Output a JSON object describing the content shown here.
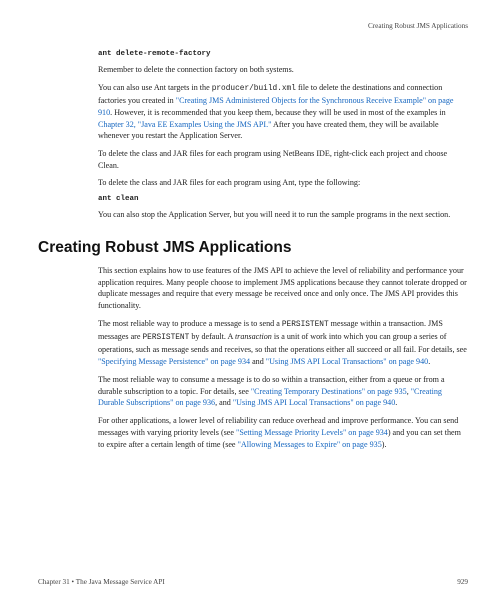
{
  "running_header": "Creating Robust JMS Applications",
  "code1": "ant delete-remote-factory",
  "para1": "Remember to delete the connection factory on both systems.",
  "para2_a": "You can also use Ant targets in the ",
  "para2_mono1": "producer/build.xml",
  "para2_b": " file to delete the destinations and connection factories you created in ",
  "para2_link1": "\"Creating JMS Administered Objects for the Synchronous Receive Example\" on page 910",
  "para2_c": ". However, it is recommended that you keep them, because they will be used in most of the examples in ",
  "para2_link2": "Chapter 32, \"Java EE Examples Using the JMS API.\"",
  "para2_d": " After you have created them, they will be available whenever you restart the Application Server.",
  "para3": "To delete the class and JAR files for each program using NetBeans IDE, right-click each project and choose Clean.",
  "para4": "To delete the class and JAR files for each program using Ant, type the following:",
  "code2": "ant clean",
  "para5": "You can also stop the Application Server, but you will need it to run the sample programs in the next section.",
  "heading": "Creating Robust JMS Applications",
  "para6": "This section explains how to use features of the JMS API to achieve the level of reliability and performance your application requires. Many people choose to implement JMS applications because they cannot tolerate dropped or duplicate messages and require that every message be received once and only once. The JMS API provides this functionality.",
  "para7_a": "The most reliable way to produce a message is to send a ",
  "para7_mono1": "PERSISTENT",
  "para7_b": " message within a transaction. JMS messages are ",
  "para7_mono2": "PERSISTENT",
  "para7_c": " by default. A ",
  "para7_italic": "transaction",
  "para7_d": " is a unit of work into which you can group a series of operations, such as message sends and receives, so that the operations either all succeed or all fail. For details, see ",
  "para7_link1": "\"Specifying Message Persistence\" on page 934",
  "para7_e": " and ",
  "para7_link2": "\"Using JMS API Local Transactions\" on page 940",
  "para7_f": ".",
  "para8_a": "The most reliable way to consume a message is to do so within a transaction, either from a queue or from a durable subscription to a topic. For details, see ",
  "para8_link1": "\"Creating Temporary Destinations\" on page 935",
  "para8_b": ", ",
  "para8_link2": "\"Creating Durable Subscriptions\" on page 936",
  "para8_c": ", and ",
  "para8_link3": "\"Using JMS API Local Transactions\" on page 940",
  "para8_d": ".",
  "para9_a": "For other applications, a lower level of reliability can reduce overhead and improve performance. You can send messages with varying priority levels (see ",
  "para9_link1": "\"Setting Message Priority Levels\" on page 934",
  "para9_b": ") and you can set them to expire after a certain length of time (see ",
  "para9_link2": "\"Allowing Messages to Expire\" on page 935",
  "para9_c": ").",
  "footer_left": "Chapter 31 • The Java Message Service API",
  "footer_right": "929"
}
